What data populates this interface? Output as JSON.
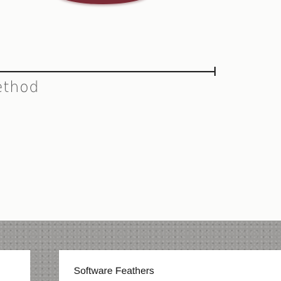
{
  "ruler": {
    "label": "ethod"
  },
  "card": {
    "title": "Software Feathers"
  },
  "colors": {
    "accent_shape": "#7c2a35",
    "band": "#9b9a98",
    "background": "#fbfbfa"
  }
}
